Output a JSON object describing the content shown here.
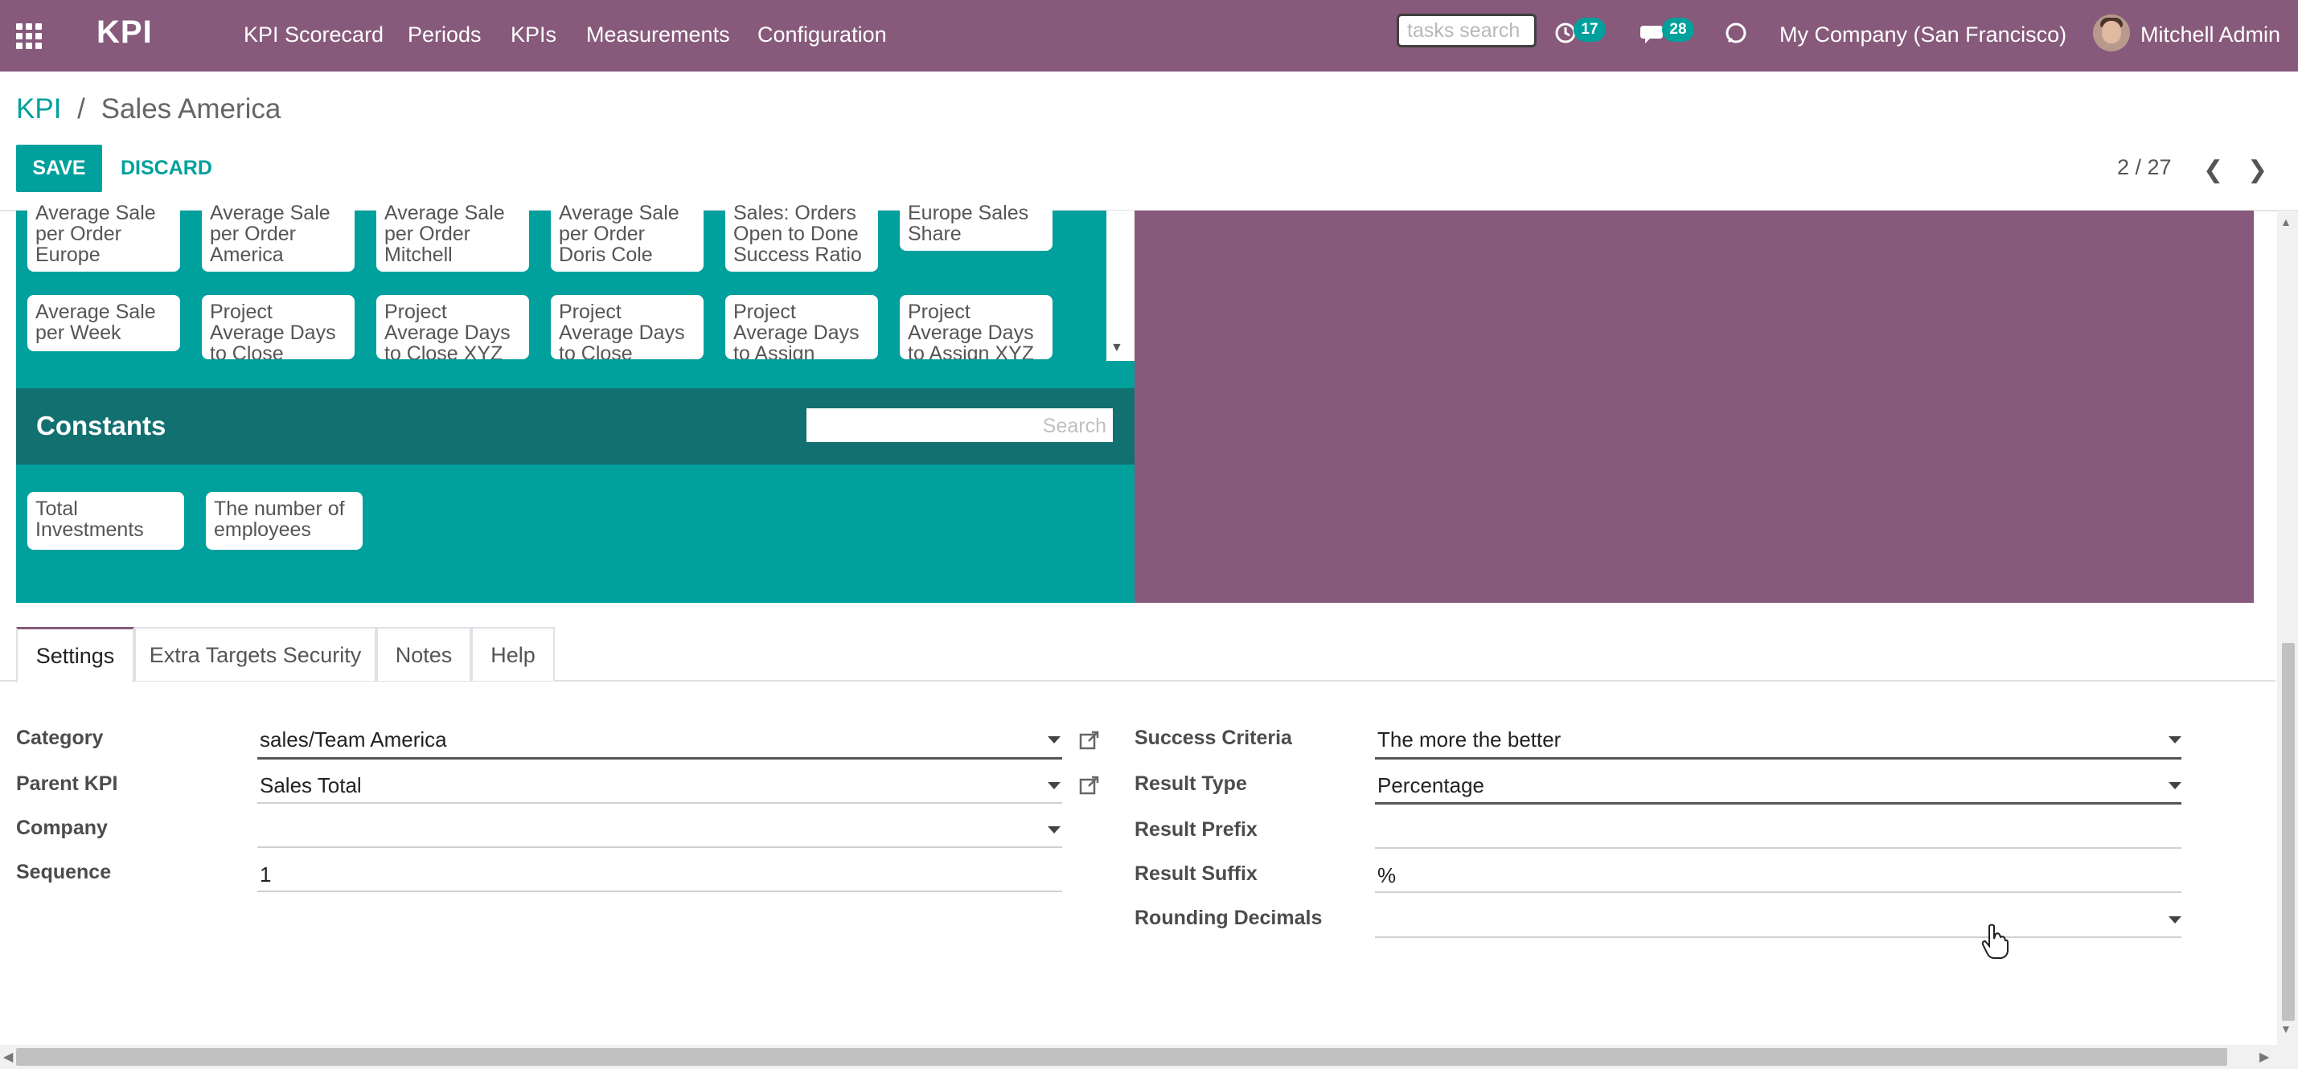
{
  "navbar": {
    "brand": "KPI",
    "menu": [
      "KPI Scorecard",
      "Periods",
      "KPIs",
      "Measurements",
      "Configuration"
    ],
    "search_placeholder": "tasks search",
    "activity_count": "17",
    "messages_count": "28",
    "company": "My Company (San Francisco)",
    "user": "Mitchell Admin"
  },
  "breadcrumb": {
    "parent": "KPI",
    "separator": "/",
    "current": "Sales America"
  },
  "buttons": {
    "save": "SAVE",
    "discard": "DISCARD"
  },
  "pager": {
    "value": "2 / 27"
  },
  "measurements": [
    "Average Sale per Order Europe",
    "Average Sale per Order America",
    "Average Sale per Order Mitchell",
    "Average Sale per Order Doris Cole",
    "Sales: Orders Open to Done Success Ratio",
    "Europe Sales Share",
    "Average Sale per Week",
    "Project Average Days to Close",
    "Project Average Days to Close XYZ",
    "Project Average Days to Close",
    "Project Average Days to Assign",
    "Project Average Days to Assign XYZ"
  ],
  "constants": {
    "title": "Constants",
    "search_placeholder": "Search",
    "items": [
      "Total Investments",
      "The number of employees"
    ]
  },
  "tabs": [
    "Settings",
    "Extra Targets Security",
    "Notes",
    "Help"
  ],
  "form_left": [
    {
      "label": "Category",
      "value": "sales/Team America"
    },
    {
      "label": "Parent KPI",
      "value": "Sales Total"
    },
    {
      "label": "Company",
      "value": ""
    },
    {
      "label": "Sequence",
      "value": "1"
    }
  ],
  "form_right": [
    {
      "label": "Success Criteria",
      "value": "The more the better"
    },
    {
      "label": "Result Type",
      "value": "Percentage"
    },
    {
      "label": "Result Prefix",
      "value": ""
    },
    {
      "label": "Result Suffix",
      "value": "%"
    },
    {
      "label": "Rounding Decimals",
      "value": ""
    }
  ],
  "colors": {
    "brand": "#875a7b",
    "accent": "#00a09d",
    "constants_header": "#127070"
  }
}
